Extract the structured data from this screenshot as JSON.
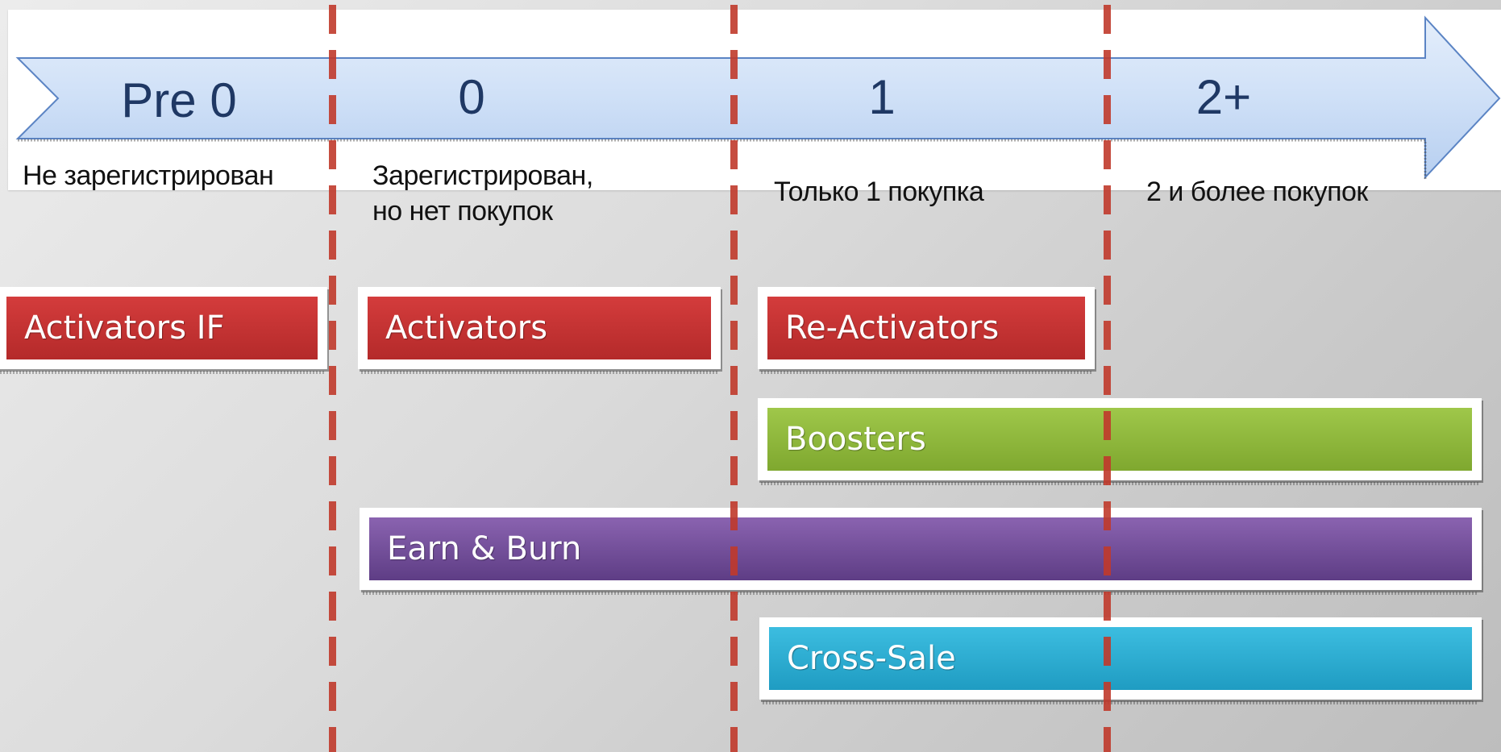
{
  "stages": [
    {
      "label": "Pre 0",
      "description": "Не зарегистрирован"
    },
    {
      "label": "0",
      "description": "Зарегистрирован,\nно нет покупок"
    },
    {
      "label": "1",
      "description": "Только 1 покупка"
    },
    {
      "label": "2+",
      "description": "2 и более покупок"
    }
  ],
  "bars": [
    {
      "label": "Activators IF",
      "color": "#c43333"
    },
    {
      "label": "Activators",
      "color": "#c43333"
    },
    {
      "label": "Re-Activators",
      "color": "#c43333"
    },
    {
      "label": "Boosters",
      "color": "#8db83c"
    },
    {
      "label": "Earn & Burn",
      "color": "#73509c"
    },
    {
      "label": "Cross-Sale",
      "color": "#2eaed6"
    }
  ],
  "colors": {
    "arrow_fill": "#cfe0f7",
    "arrow_stroke": "#5b84c4",
    "divider": "#c0392b",
    "stage_text": "#1f3864"
  }
}
